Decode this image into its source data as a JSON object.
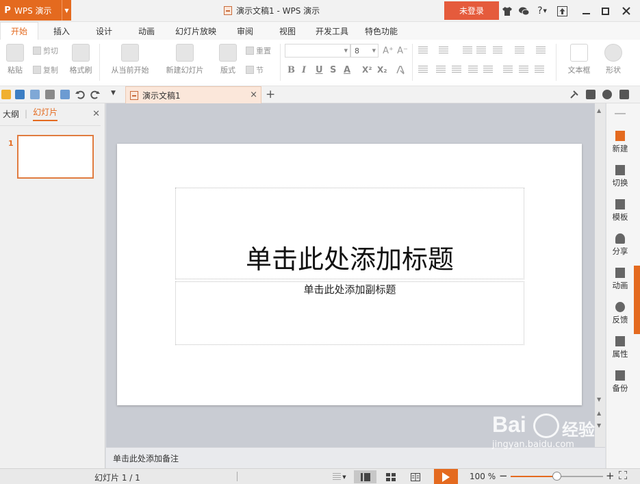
{
  "titlebar": {
    "app_name": "WPS 演示",
    "app_logo": "P",
    "window_title": "演示文稿1 - WPS 演示",
    "login_label": "未登录",
    "help_label": "?"
  },
  "menu": {
    "tabs": [
      "开始",
      "插入",
      "设计",
      "动画",
      "幻灯片放映",
      "审阅",
      "视图",
      "开发工具",
      "特色功能"
    ],
    "active_index": 0
  },
  "ribbon": {
    "paste": "粘贴",
    "cut": "剪切",
    "copy": "复制",
    "format_painter": "格式刷",
    "from_current": "从当前开始",
    "new_slide": "新建幻灯片",
    "layout": "版式",
    "reset": "重置",
    "section": "节",
    "font_name": "",
    "font_size": "8",
    "bold": "B",
    "italic": "I",
    "underline": "U",
    "shadow": "S",
    "font_color": "A",
    "superscript": "X²",
    "subscript": "X₂",
    "grow_font": "A⁺",
    "shrink_font": "A⁻",
    "textbox": "文本框",
    "shape": "形状"
  },
  "doc_tabs": {
    "active_doc": "演示文稿1"
  },
  "left_panel": {
    "tab_outline": "大纲",
    "tab_slides": "幻灯片",
    "slide_number": "1"
  },
  "slide": {
    "title_placeholder": "单击此处添加标题",
    "subtitle_placeholder": "单击此处添加副标题"
  },
  "notes": {
    "placeholder": "单击此处添加备注"
  },
  "right_pane": {
    "items": [
      "新建",
      "切换",
      "模板",
      "分享",
      "动画",
      "反馈",
      "属性",
      "备份"
    ]
  },
  "status": {
    "slide_counter": "幻灯片 1 / 1",
    "zoom": "100 %",
    "zoom_fraction": 0.5
  },
  "watermark": {
    "brand": "Bai",
    "brand_cn": "经验",
    "url": "jingyan.baidu.com"
  },
  "colors": {
    "accent": "#e46a1f",
    "login": "#e55b3c"
  }
}
